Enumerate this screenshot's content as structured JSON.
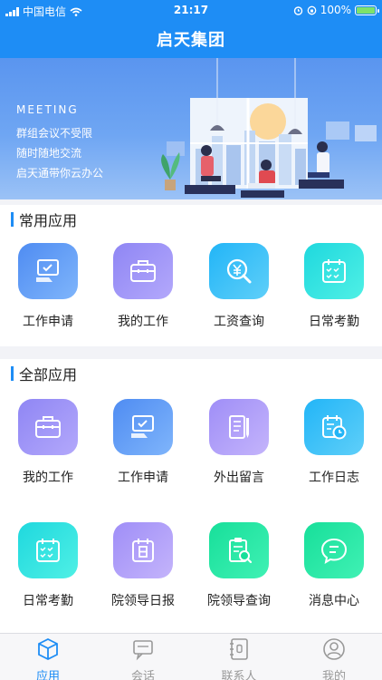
{
  "status": {
    "carrier": "中国电信",
    "time": "21:17",
    "battery": "100%"
  },
  "nav": {
    "title": "启天集团"
  },
  "banner": {
    "heading": "MEETING",
    "lines": [
      "群组会议不受限",
      "随时随地交流",
      "启天通带你云办公"
    ]
  },
  "common": {
    "title": "常用应用",
    "items": [
      {
        "label": "工作申请",
        "icon": "form-check-icon"
      },
      {
        "label": "我的工作",
        "icon": "briefcase-icon"
      },
      {
        "label": "工资查询",
        "icon": "yuan-search-icon"
      },
      {
        "label": "日常考勤",
        "icon": "calendar-check-icon"
      }
    ]
  },
  "all": {
    "title": "全部应用",
    "items": [
      {
        "label": "我的工作",
        "icon": "briefcase-icon"
      },
      {
        "label": "工作申请",
        "icon": "form-check-icon"
      },
      {
        "label": "外出留言",
        "icon": "notebook-pen-icon"
      },
      {
        "label": "工作日志",
        "icon": "calendar-clock-icon"
      },
      {
        "label": "日常考勤",
        "icon": "calendar-check-icon"
      },
      {
        "label": "院领导日报",
        "icon": "calendar-day-icon"
      },
      {
        "label": "院领导查询",
        "icon": "clipboard-search-icon"
      },
      {
        "label": "消息中心",
        "icon": "chat-bubble-icon"
      }
    ]
  },
  "tabs": [
    {
      "label": "应用",
      "icon": "cube-icon",
      "active": true
    },
    {
      "label": "会话",
      "icon": "chat-icon",
      "active": false
    },
    {
      "label": "联系人",
      "icon": "contacts-book-icon",
      "active": false
    },
    {
      "label": "我的",
      "icon": "user-icon",
      "active": false
    }
  ],
  "colors": {
    "primary": "#1e8df5"
  }
}
